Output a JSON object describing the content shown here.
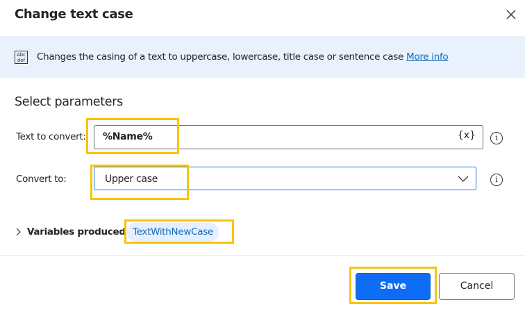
{
  "dialog": {
    "title": "Change text case",
    "close_icon": "close-icon"
  },
  "banner": {
    "icon_text": "Abc def",
    "description": "Changes the casing of a text to uppercase, lowercase, title case or sentence case",
    "link": "More info"
  },
  "section_title": "Select parameters",
  "params": {
    "text_to_convert": {
      "label": "Text to convert:",
      "value": "%Name%",
      "variable_button": "{x}"
    },
    "convert_to": {
      "label": "Convert to:",
      "value": "Upper case"
    }
  },
  "variables": {
    "label": "Variables produced",
    "items": [
      "TextWithNewCase"
    ]
  },
  "footer": {
    "save": "Save",
    "cancel": "Cancel"
  },
  "colors": {
    "accent": "#0f6cf5",
    "highlight": "#f8c40c",
    "banner": "#e8f1fc"
  }
}
